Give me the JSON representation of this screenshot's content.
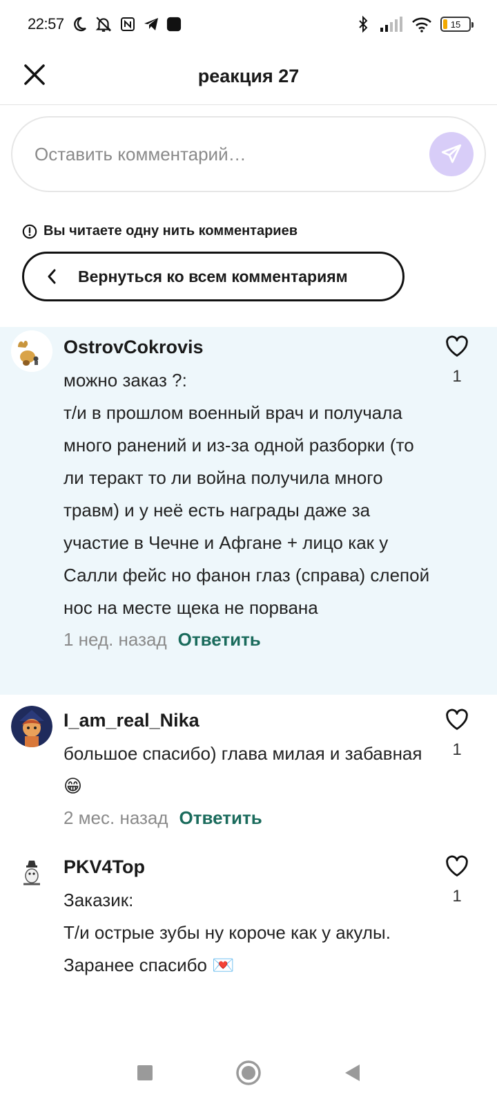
{
  "status_bar": {
    "time": "22:57",
    "battery": "15",
    "icons": [
      "moon-icon",
      "bell-off-icon",
      "nfc-icon",
      "telegram-icon",
      "app-icon",
      "bluetooth-icon",
      "signal-icon",
      "wifi-icon",
      "battery-icon"
    ]
  },
  "header": {
    "title": "реакция 27"
  },
  "comment_input": {
    "placeholder": "Оставить комментарий…"
  },
  "thread": {
    "note": "Вы читаете одну нить комментариев",
    "back_label": "Вернуться ко всем комментариям"
  },
  "comments": [
    {
      "author": "OstrovCokrovis",
      "text": "можно заказ ?:\nт/и в прошлом военный врач и получала много ранений и из-за одной разборки (то ли теракт то ли война получила много травм) и у неё есть награды даже за участие в Чечне и Афгане + лицо как у Салли фейс но фанон глаз (справа) слепой нос на месте щека не порвана",
      "time": "1 нед. назад",
      "reply": "Ответить",
      "likes": "1",
      "highlighted": true
    },
    {
      "author": "I_am_real_Nika",
      "text": "большое спасибо) глава милая и забавная😁",
      "time": "2 мес. назад",
      "reply": "Ответить",
      "likes": "1",
      "highlighted": false
    },
    {
      "author": "PKV4Top",
      "text": "Заказик:\nТ/и острые зубы ну короче как у акулы.\nЗаранее спасибо 💌",
      "likes": "1",
      "highlighted": false
    }
  ],
  "colors": {
    "accent_reply": "#1a6b5c",
    "highlight_bg": "#eef7fb",
    "send_button": "#d8cdf8"
  }
}
